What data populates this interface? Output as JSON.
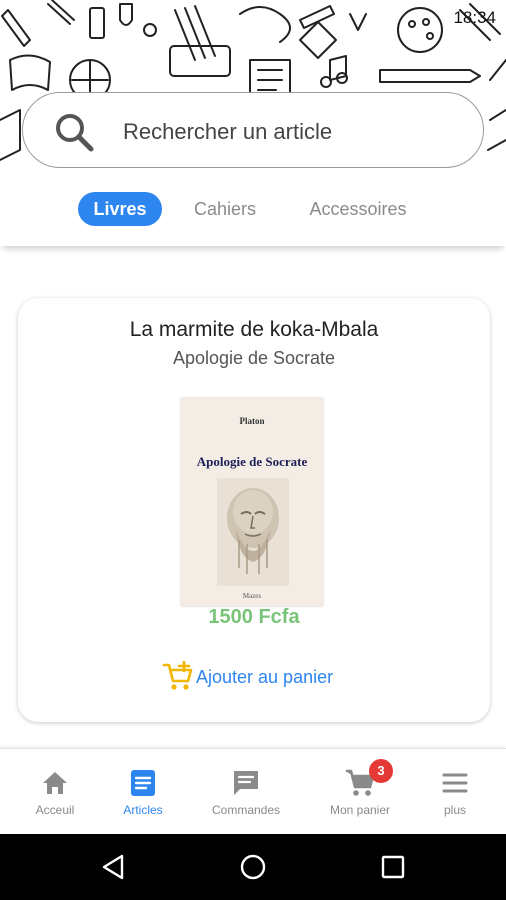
{
  "status_bar": {
    "time": "18:34"
  },
  "search": {
    "placeholder": "Rechercher un article"
  },
  "tabs": [
    {
      "label": "Livres",
      "active": true
    },
    {
      "label": "Cahiers",
      "active": false
    },
    {
      "label": "Accessoires",
      "active": false
    }
  ],
  "product": {
    "title": "La marmite de koka-Mbala",
    "subtitle": "Apologie de Socrate",
    "cover": {
      "author": "Platon",
      "title": "Apologie de Socrate",
      "publisher": "Mazes"
    },
    "price": "1500 Fcfa",
    "add_to_cart_label": "Ajouter au panier"
  },
  "bottom_nav": {
    "items": [
      {
        "label": "Acceuil",
        "icon": "home-icon",
        "active": false
      },
      {
        "label": "Articles",
        "icon": "articles-icon",
        "active": true
      },
      {
        "label": "Commandes",
        "icon": "chat-icon",
        "active": false
      },
      {
        "label": "Mon panier",
        "icon": "cart-icon",
        "active": false,
        "badge": "3"
      },
      {
        "label": "plus",
        "icon": "menu-icon",
        "active": false
      }
    ]
  },
  "colors": {
    "accent": "#2d86f0",
    "price": "#7ac47a",
    "badge": "#e53935",
    "cart_icon": "#f2b705"
  }
}
